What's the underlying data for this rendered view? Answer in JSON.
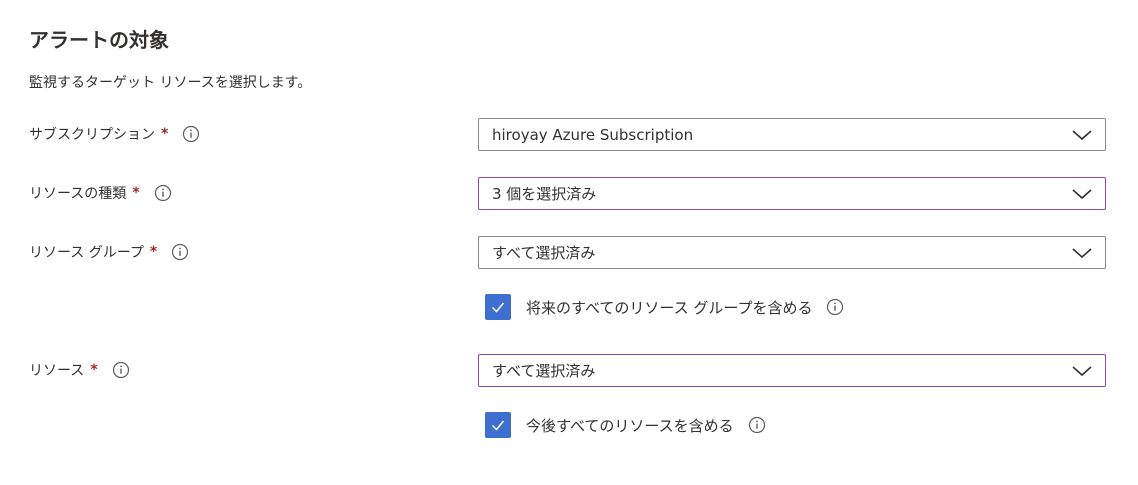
{
  "section": {
    "title": "アラートの対象",
    "description": "監視するターゲット リソースを選択します。"
  },
  "fields": [
    {
      "label": "サブスクリプション",
      "required_mark": "*",
      "info_icon": "info-icon",
      "value": "hiroyay Azure Subscription"
    },
    {
      "label": "リソースの種類",
      "required_mark": "*",
      "info_icon": "info-icon",
      "value": "3 個を選択済み"
    },
    {
      "label": "リソース グループ",
      "required_mark": "*",
      "info_icon": "info-icon",
      "value": "すべて選択済み"
    },
    {
      "label": "リソース",
      "required_mark": "*",
      "info_icon": "info-icon",
      "value": "すべて選択済み"
    }
  ],
  "checkboxes": [
    {
      "label": "将来のすべてのリソース グループを含める",
      "checked": true,
      "info_icon": "info-icon"
    },
    {
      "label": "今後すべてのリソースを含める",
      "checked": true,
      "info_icon": "info-icon"
    }
  ],
  "colors": {
    "required": "#a4262c",
    "checkbox_fill": "#3d6fd1",
    "focused_border": "#8a4f9e",
    "default_border": "#8a8886",
    "text": "#323130"
  }
}
